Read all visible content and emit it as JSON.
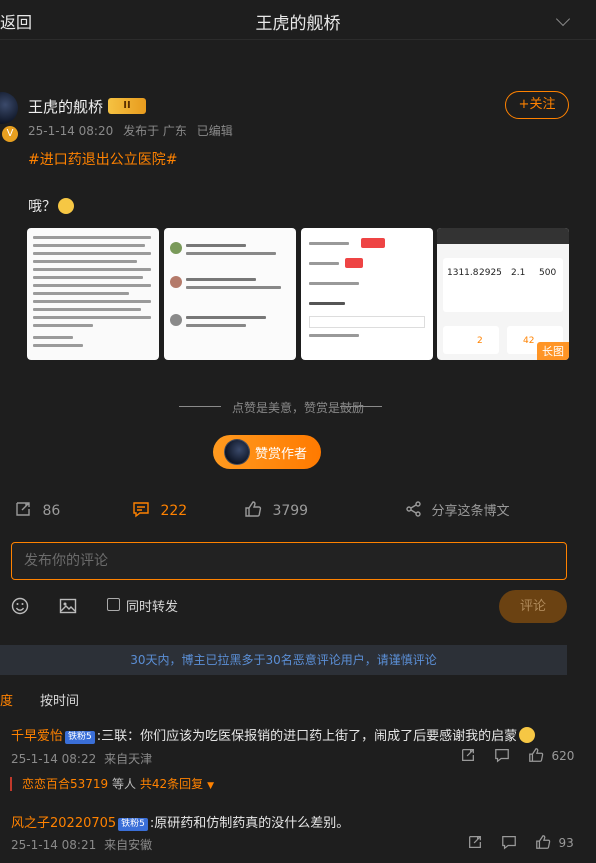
{
  "topbar": {
    "back_label": "返回",
    "title": "王虎的舰桥"
  },
  "post": {
    "author": "王虎的舰桥",
    "badge": "II",
    "follow_label": "+关注",
    "date": "25-1-14 08:20",
    "location": "发布于 广东",
    "edited": "已编辑",
    "hashtag": "#进口药退出公立医院#",
    "text": "哦？",
    "long_image_label": "长图",
    "like_hint": "点赞是美意，赞赏是鼓励",
    "reward_label": "赞赏作者",
    "reposts": "86",
    "comments": "222",
    "likes": "3799",
    "share_label": "分享这条博文"
  },
  "thumb3": {
    "r1": "1311.8",
    "r2": "2925",
    "r3": "2.1",
    "r4": "500",
    "n1": "2",
    "n2": "42"
  },
  "composer": {
    "placeholder": "发布你的评论",
    "repost_label": "同时转发",
    "submit_label": "评论"
  },
  "notice": "30天内，博主已拉黑多于30名恶意评论用户，请谨慎评论",
  "sort": {
    "hot": "度",
    "time": "按时间"
  },
  "comments": [
    {
      "user": "千早爱怡",
      "vip": "铁粉5",
      "text": ":三联：你们应该为吃医保报销的进口药上街了，闹成了后要感谢我的启蒙",
      "date": "25-1-14 08:22",
      "from": "来自天津",
      "likes": "620",
      "reply_user": "恋恋百合53719",
      "reply_mid": " 等人 ",
      "reply_count": "共42条回复"
    },
    {
      "user": "风之子20220705",
      "vip": "铁粉5",
      "text": ":原研药和仿制药真的没什么差别。",
      "date": "25-1-14 08:21",
      "from": "来自安徽",
      "likes": "93"
    }
  ],
  "colors": {
    "accent": "#ff8200",
    "bg": "#1e1e1e",
    "link": "#5b8fd6"
  },
  "icons": [
    "chevron-down-icon",
    "repost-icon",
    "comment-icon",
    "like-icon",
    "share-icon",
    "emoji-icon",
    "image-icon",
    "reply-icon"
  ]
}
